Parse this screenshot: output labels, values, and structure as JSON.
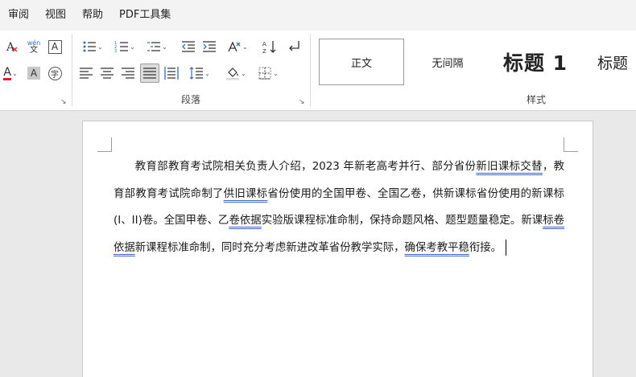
{
  "menu": [
    "审阅",
    "视图",
    "帮助",
    "PDF工具集"
  ],
  "ribbon": {
    "font_group": {
      "pinyin_top": "wén",
      "pinyin_bottom": "文",
      "border_char": "A",
      "font_color_char": "A",
      "shade_char": "A",
      "circle_char": "字"
    },
    "paragraph_group": {
      "label": "段落"
    },
    "styles_group": {
      "label": "样式",
      "items": [
        "正文",
        "无间隔",
        "标题 1",
        "标题"
      ]
    }
  },
  "document": {
    "segments": [
      {
        "text": "教育部教育考试院相关负责人介绍，2023 年新老高考并行、部分省份",
        "u": false
      },
      {
        "text": "新旧课标交替",
        "u": true
      },
      {
        "text": "，教育部教育考试院命制了",
        "u": false
      },
      {
        "text": "供旧课标",
        "u": true
      },
      {
        "text": "省份使用的全国甲卷、全国乙卷，供新课标省份使用的新课标(I、II)卷。全国甲卷、乙",
        "u": false
      },
      {
        "text": "卷依据",
        "u": true
      },
      {
        "text": "实验版课程标准命制，保持命题风格、题型题量稳定。新课",
        "u": false
      },
      {
        "text": "标卷依据",
        "u": true
      },
      {
        "text": "新课程标准命制，同时充分考虑新进改革省份教学实际，",
        "u": false
      },
      {
        "text": "确保考教平稳",
        "u": true
      },
      {
        "text": "衔接。",
        "u": false
      }
    ]
  },
  "colors": {
    "accent_red": "#e02020",
    "squiggle_blue": "#3b64c8"
  }
}
